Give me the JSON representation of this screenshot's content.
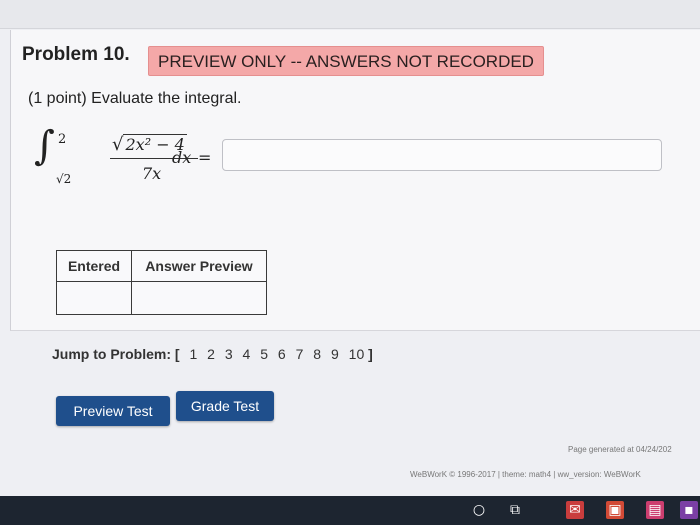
{
  "problem": {
    "title": "Problem 10.",
    "banner": "PREVIEW ONLY -- ANSWERS NOT RECORDED",
    "instruction": "(1 point) Evaluate the integral.",
    "integral": {
      "upper_limit": "2",
      "lower_limit": "√2",
      "radical": "√",
      "numerator_radicand": "2x² − 4",
      "denominator": "7x",
      "differential": "dx",
      "equals": "="
    },
    "answer_value": ""
  },
  "results_table": {
    "headers": [
      "Entered",
      "Answer Preview"
    ],
    "rows": [
      [
        "",
        ""
      ]
    ]
  },
  "jump": {
    "label": "Jump to Problem:",
    "open_bracket": "[",
    "close_bracket": "]",
    "pages": [
      "1",
      "2",
      "3",
      "4",
      "5",
      "6",
      "7",
      "8",
      "9",
      "10"
    ]
  },
  "buttons": {
    "preview": "Preview Test",
    "grade": "Grade Test"
  },
  "footer": {
    "page_generated": "Page generated at 04/24/202",
    "copyright": "WeBWorK © 1996-2017 | theme: math4 | ww_version: WeBWorK"
  },
  "colors": {
    "banner_bg": "#f4a8a8",
    "button_bg": "#1f4f8c"
  }
}
